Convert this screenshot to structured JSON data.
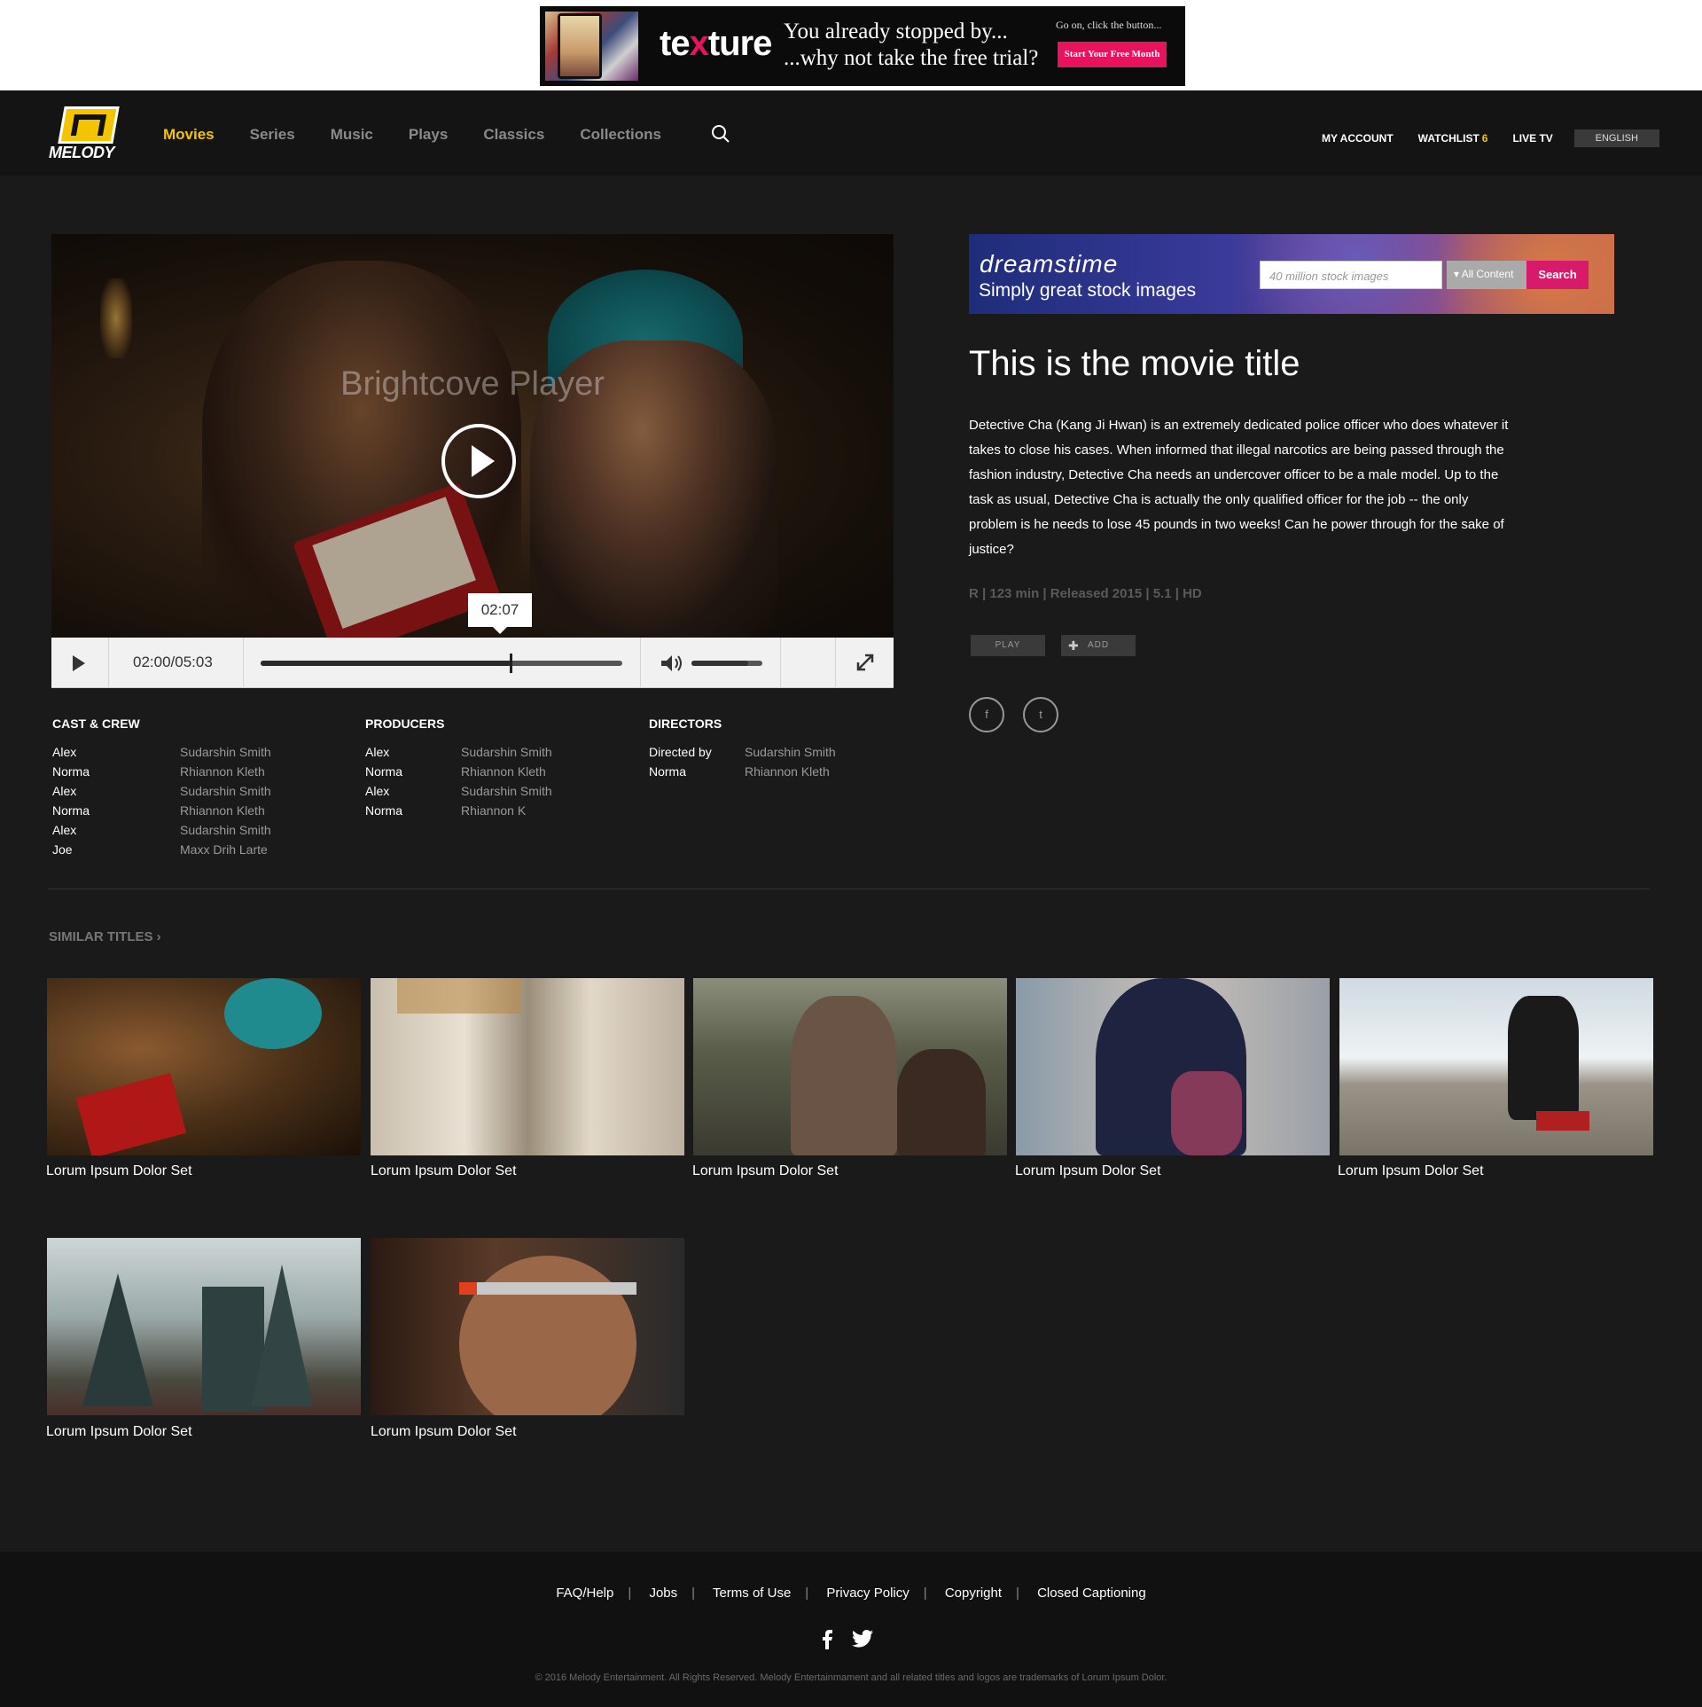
{
  "ads": {
    "texture": {
      "logo": "texture",
      "line1": "You already stopped by...",
      "line2": "...why not take the free trial?",
      "go_on": "Go on, click the button...",
      "cta": "Start Your Free Month"
    },
    "dreamstime": {
      "logo": "dreamstime",
      "tagline": "Simply great stock images",
      "search_placeholder": "40 million stock images",
      "select": "All Content",
      "button": "Search"
    }
  },
  "nav": {
    "brand": "MELODY",
    "links": [
      "Movies",
      "Series",
      "Music",
      "Plays",
      "Classics",
      "Collections"
    ],
    "active": "Movies",
    "my_account": "MY ACCOUNT",
    "watchlist": "WATCHLIST",
    "watchlist_count": "6",
    "live_tv": "LIVE TV",
    "language": "ENGLISH"
  },
  "player": {
    "label": "Brightcove Player",
    "time": "02:00/05:03",
    "tooltip": "02:07",
    "progress_fraction": 0.69,
    "buffered_fraction": 0.46,
    "volume_fraction": 0.8
  },
  "credits": {
    "cast": {
      "heading": "CAST & CREW",
      "rows": [
        {
          "role": "Alex",
          "name": "Sudarshin Smith"
        },
        {
          "role": "Norma",
          "name": "Rhiannon Kleth"
        },
        {
          "role": "Alex",
          "name": "Sudarshin Smith"
        },
        {
          "role": "Norma",
          "name": "Rhiannon Kleth"
        },
        {
          "role": "Alex",
          "name": "Sudarshin Smith"
        },
        {
          "role": "Joe",
          "name": "Maxx Drih Larte"
        }
      ]
    },
    "producers": {
      "heading": "PRODUCERS",
      "rows": [
        {
          "role": "Alex",
          "name": "Sudarshin Smith"
        },
        {
          "role": "Norma",
          "name": "Rhiannon Kleth"
        },
        {
          "role": "Alex",
          "name": "Sudarshin Smith"
        },
        {
          "role": "Norma",
          "name": "Rhiannon K"
        }
      ]
    },
    "directors": {
      "heading": "DIRECTORS",
      "rows": [
        {
          "role": "Directed by",
          "name": "Sudarshin Smith"
        },
        {
          "role": "Norma",
          "name": "Rhiannon Kleth"
        }
      ]
    }
  },
  "movie": {
    "title": "This is the movie title",
    "description": "Detective Cha (Kang Ji Hwan) is an extremely dedicated police officer who does whatever it takes to close his cases. When informed that illegal narcotics are being passed through the fashion industry, Detective Cha needs an undercover officer to be a male model. Up to the task as usual, Detective Cha is actually the only qualified officer for the job -- the only problem is he needs to lose 45 pounds in two weeks! Can he power through for the sake of justice?",
    "meta": "R | 123 min | Released 2015 | 5.1 | HD",
    "play_label": "PLAY",
    "add_label": "ADD",
    "share": {
      "facebook": "f",
      "twitter": "t"
    }
  },
  "similar": {
    "heading": "SIMILAR TITLES",
    "items": [
      "Lorum Ipsum Dolor Set",
      "Lorum Ipsum Dolor Set",
      "Lorum Ipsum Dolor Set",
      "Lorum Ipsum Dolor Set",
      "Lorum Ipsum Dolor Set",
      "Lorum Ipsum Dolor Set",
      "Lorum Ipsum Dolor Set"
    ]
  },
  "footer": {
    "links": [
      "FAQ/Help",
      "Jobs",
      "Terms of Use",
      "Privacy Policy",
      "Copyright",
      "Closed Captioning"
    ],
    "copyright": "© 2016 Melody Entertainment. All Rights Reserved. Melody Entertainmament and all related titles and logos are trademarks of Lorum Ipsum Dolor."
  }
}
